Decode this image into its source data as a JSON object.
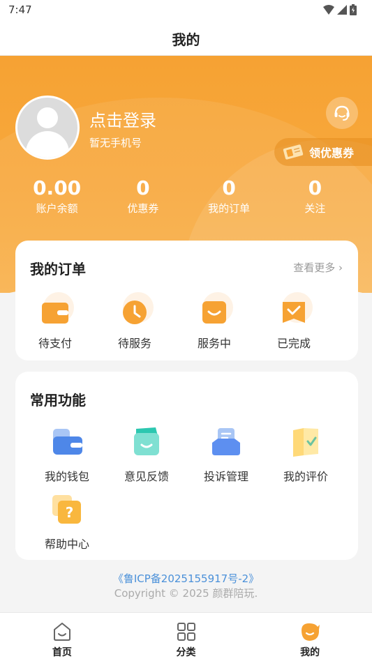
{
  "status_bar": {
    "time": "7:47"
  },
  "header": {
    "title": "我的"
  },
  "profile": {
    "login_text": "点击登录",
    "phone_text": "暂无手机号",
    "coupon_button": "领优惠券"
  },
  "stats": [
    {
      "value": "0.00",
      "label": "账户余额"
    },
    {
      "value": "0",
      "label": "优惠券"
    },
    {
      "value": "0",
      "label": "我的订单"
    },
    {
      "value": "0",
      "label": "关注"
    }
  ],
  "orders": {
    "title": "我的订单",
    "more": "查看更多 ›",
    "items": [
      {
        "label": "待支付",
        "icon": "wallet-icon"
      },
      {
        "label": "待服务",
        "icon": "clock-icon"
      },
      {
        "label": "服务中",
        "icon": "in-service-icon"
      },
      {
        "label": "已完成",
        "icon": "check-icon"
      }
    ]
  },
  "functions": {
    "title": "常用功能",
    "items": [
      {
        "label": "我的钱包",
        "icon": "wallet-icon"
      },
      {
        "label": "意见反馈",
        "icon": "feedback-icon"
      },
      {
        "label": "投诉管理",
        "icon": "complaint-icon"
      },
      {
        "label": "我的评价",
        "icon": "review-icon"
      },
      {
        "label": "帮助中心",
        "icon": "help-icon"
      }
    ]
  },
  "footer": {
    "icp": "《鲁ICP备2025155917号-2》",
    "copyright": "Copyright © 2025 颜群陪玩."
  },
  "tabbar": [
    {
      "label": "首页",
      "icon": "home-icon"
    },
    {
      "label": "分类",
      "icon": "category-icon"
    },
    {
      "label": "我的",
      "icon": "profile-icon",
      "active": true
    }
  ],
  "colors": {
    "accent": "#f6a233",
    "link": "#4a90d9"
  }
}
